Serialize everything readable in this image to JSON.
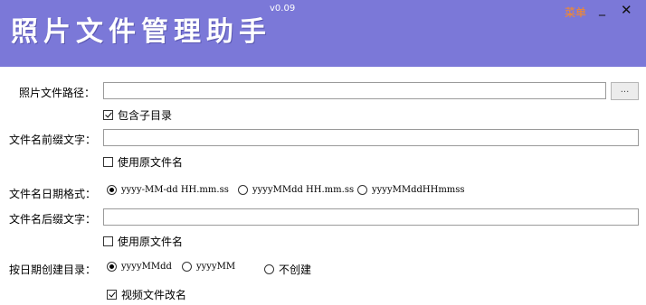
{
  "window": {
    "title": "照片文件管理助手",
    "version": "v0.09",
    "menu_label": "菜单",
    "minimize_glyph": "_",
    "close_glyph": "✕",
    "header_color": "#7b78d8",
    "menu_color": "#ff8a1e"
  },
  "form": {
    "photo_path": {
      "label": "照片文件路径：",
      "value": "",
      "browse_label": "..."
    },
    "include_subdirs": {
      "label": "包含子目录",
      "checked": true
    },
    "prefix": {
      "label": "文件名前缀文字：",
      "value": ""
    },
    "prefix_use_original": {
      "label": "使用原文件名",
      "checked": false
    },
    "date_format": {
      "label": "文件名日期格式：",
      "options": [
        "yyyy-MM-dd HH.mm.ss",
        "yyyyMMdd HH.mm.ss",
        "yyyyMMddHHmmss"
      ],
      "selected": 0
    },
    "suffix": {
      "label": "文件名后缀文字：",
      "value": ""
    },
    "suffix_use_original": {
      "label": "使用原文件名",
      "checked": false
    },
    "date_dir": {
      "label": "按日期创建目录：",
      "options": [
        "yyyyMMdd",
        "yyyyMM",
        "不创建"
      ],
      "selected": 0
    },
    "rename_video": {
      "label": "视频文件改名",
      "checked": true
    }
  }
}
